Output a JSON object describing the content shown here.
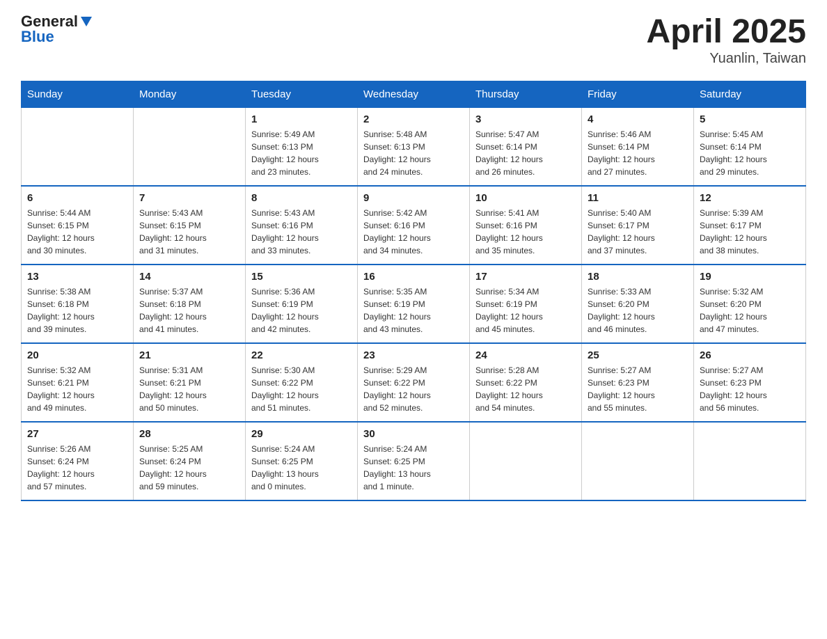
{
  "header": {
    "logo_general": "General",
    "logo_blue": "Blue",
    "title": "April 2025",
    "subtitle": "Yuanlin, Taiwan"
  },
  "calendar": {
    "days_of_week": [
      "Sunday",
      "Monday",
      "Tuesday",
      "Wednesday",
      "Thursday",
      "Friday",
      "Saturday"
    ],
    "weeks": [
      [
        {
          "day": "",
          "info": ""
        },
        {
          "day": "",
          "info": ""
        },
        {
          "day": "1",
          "info": "Sunrise: 5:49 AM\nSunset: 6:13 PM\nDaylight: 12 hours\nand 23 minutes."
        },
        {
          "day": "2",
          "info": "Sunrise: 5:48 AM\nSunset: 6:13 PM\nDaylight: 12 hours\nand 24 minutes."
        },
        {
          "day": "3",
          "info": "Sunrise: 5:47 AM\nSunset: 6:14 PM\nDaylight: 12 hours\nand 26 minutes."
        },
        {
          "day": "4",
          "info": "Sunrise: 5:46 AM\nSunset: 6:14 PM\nDaylight: 12 hours\nand 27 minutes."
        },
        {
          "day": "5",
          "info": "Sunrise: 5:45 AM\nSunset: 6:14 PM\nDaylight: 12 hours\nand 29 minutes."
        }
      ],
      [
        {
          "day": "6",
          "info": "Sunrise: 5:44 AM\nSunset: 6:15 PM\nDaylight: 12 hours\nand 30 minutes."
        },
        {
          "day": "7",
          "info": "Sunrise: 5:43 AM\nSunset: 6:15 PM\nDaylight: 12 hours\nand 31 minutes."
        },
        {
          "day": "8",
          "info": "Sunrise: 5:43 AM\nSunset: 6:16 PM\nDaylight: 12 hours\nand 33 minutes."
        },
        {
          "day": "9",
          "info": "Sunrise: 5:42 AM\nSunset: 6:16 PM\nDaylight: 12 hours\nand 34 minutes."
        },
        {
          "day": "10",
          "info": "Sunrise: 5:41 AM\nSunset: 6:16 PM\nDaylight: 12 hours\nand 35 minutes."
        },
        {
          "day": "11",
          "info": "Sunrise: 5:40 AM\nSunset: 6:17 PM\nDaylight: 12 hours\nand 37 minutes."
        },
        {
          "day": "12",
          "info": "Sunrise: 5:39 AM\nSunset: 6:17 PM\nDaylight: 12 hours\nand 38 minutes."
        }
      ],
      [
        {
          "day": "13",
          "info": "Sunrise: 5:38 AM\nSunset: 6:18 PM\nDaylight: 12 hours\nand 39 minutes."
        },
        {
          "day": "14",
          "info": "Sunrise: 5:37 AM\nSunset: 6:18 PM\nDaylight: 12 hours\nand 41 minutes."
        },
        {
          "day": "15",
          "info": "Sunrise: 5:36 AM\nSunset: 6:19 PM\nDaylight: 12 hours\nand 42 minutes."
        },
        {
          "day": "16",
          "info": "Sunrise: 5:35 AM\nSunset: 6:19 PM\nDaylight: 12 hours\nand 43 minutes."
        },
        {
          "day": "17",
          "info": "Sunrise: 5:34 AM\nSunset: 6:19 PM\nDaylight: 12 hours\nand 45 minutes."
        },
        {
          "day": "18",
          "info": "Sunrise: 5:33 AM\nSunset: 6:20 PM\nDaylight: 12 hours\nand 46 minutes."
        },
        {
          "day": "19",
          "info": "Sunrise: 5:32 AM\nSunset: 6:20 PM\nDaylight: 12 hours\nand 47 minutes."
        }
      ],
      [
        {
          "day": "20",
          "info": "Sunrise: 5:32 AM\nSunset: 6:21 PM\nDaylight: 12 hours\nand 49 minutes."
        },
        {
          "day": "21",
          "info": "Sunrise: 5:31 AM\nSunset: 6:21 PM\nDaylight: 12 hours\nand 50 minutes."
        },
        {
          "day": "22",
          "info": "Sunrise: 5:30 AM\nSunset: 6:22 PM\nDaylight: 12 hours\nand 51 minutes."
        },
        {
          "day": "23",
          "info": "Sunrise: 5:29 AM\nSunset: 6:22 PM\nDaylight: 12 hours\nand 52 minutes."
        },
        {
          "day": "24",
          "info": "Sunrise: 5:28 AM\nSunset: 6:22 PM\nDaylight: 12 hours\nand 54 minutes."
        },
        {
          "day": "25",
          "info": "Sunrise: 5:27 AM\nSunset: 6:23 PM\nDaylight: 12 hours\nand 55 minutes."
        },
        {
          "day": "26",
          "info": "Sunrise: 5:27 AM\nSunset: 6:23 PM\nDaylight: 12 hours\nand 56 minutes."
        }
      ],
      [
        {
          "day": "27",
          "info": "Sunrise: 5:26 AM\nSunset: 6:24 PM\nDaylight: 12 hours\nand 57 minutes."
        },
        {
          "day": "28",
          "info": "Sunrise: 5:25 AM\nSunset: 6:24 PM\nDaylight: 12 hours\nand 59 minutes."
        },
        {
          "day": "29",
          "info": "Sunrise: 5:24 AM\nSunset: 6:25 PM\nDaylight: 13 hours\nand 0 minutes."
        },
        {
          "day": "30",
          "info": "Sunrise: 5:24 AM\nSunset: 6:25 PM\nDaylight: 13 hours\nand 1 minute."
        },
        {
          "day": "",
          "info": ""
        },
        {
          "day": "",
          "info": ""
        },
        {
          "day": "",
          "info": ""
        }
      ]
    ]
  }
}
